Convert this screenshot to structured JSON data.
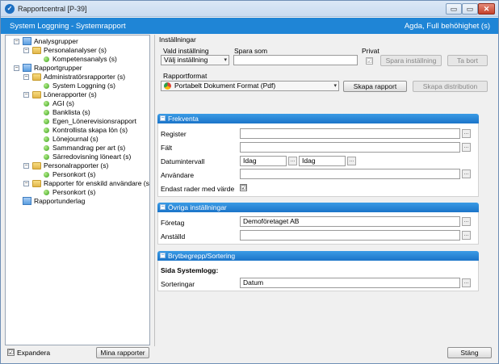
{
  "window": {
    "title": "Rapportcentral [P-39]",
    "min": "▭",
    "max": "▭",
    "close": "✕"
  },
  "header": {
    "left": "System Loggning - Systemrapport",
    "right": "Agda, Full behöhighet (s)"
  },
  "tree": {
    "items": [
      {
        "label": "Analysgrupper"
      },
      {
        "label": "Personalanalyser (s)"
      },
      {
        "label": "Kompetensanalys (s)"
      },
      {
        "label": "Rapportgrupper"
      },
      {
        "label": "Administratörsrapporter (s)"
      },
      {
        "label": "System Loggning (s)"
      },
      {
        "label": "Lönerapporter (s)"
      },
      {
        "label": "AGI (s)"
      },
      {
        "label": "Banklista (s)"
      },
      {
        "label": "Egen_Lönerevisionsrapport"
      },
      {
        "label": "Kontrollista skapa lön (s)"
      },
      {
        "label": "Lönejournal (s)"
      },
      {
        "label": "Sammandrag per art (s)"
      },
      {
        "label": "Särredovisning löneart (s)"
      },
      {
        "label": "Personalrapporter (s)"
      },
      {
        "label": "Personkort (s)"
      },
      {
        "label": "Rapporter för enskild användare (s)"
      },
      {
        "label": "Personkort (s)"
      },
      {
        "label": "Rapportunderlag"
      }
    ],
    "expand_label": "Expandera",
    "expand_checked": "☑",
    "mina_rapporter": "Mina rapporter"
  },
  "settings": {
    "title": "Inställningar",
    "vald_label": "Vald inställning",
    "vald_value": "Välj inställning",
    "spara_som_label": "Spara som",
    "spara_som_value": "",
    "privat_label": "Privat",
    "spara_button": "Spara inställning",
    "ta_bort_button": "Ta bort",
    "format_label": "Rapportformat",
    "format_value": "Portabelt Dokument Format (Pdf)",
    "skapa_rapport": "Skapa rapport",
    "skapa_distribution": "Skapa distribution"
  },
  "frekventa": {
    "title": "Frekventa",
    "register_label": "Register",
    "falt_label": "Fält",
    "datum_label": "Datumintervall",
    "datum_from": "Idag",
    "datum_to": "Idag",
    "anvandare_label": "Användare",
    "endast_label": "Endast rader med värde",
    "endast_checked": "☑"
  },
  "ovriga": {
    "title": "Övriga inställningar",
    "foretag_label": "Företag",
    "foretag_value": "Demoföretaget AB",
    "anstalld_label": "Anställd"
  },
  "bryt": {
    "title": "Brytbegrepp/Sortering",
    "sida_label": "Sida Systemlogg:",
    "sort_label": "Sorteringar",
    "sort_value": "Datum"
  },
  "footer": {
    "stang": "Stäng"
  },
  "glyphs": {
    "collapse": "−",
    "dots": "...",
    "arrow": "▾"
  }
}
